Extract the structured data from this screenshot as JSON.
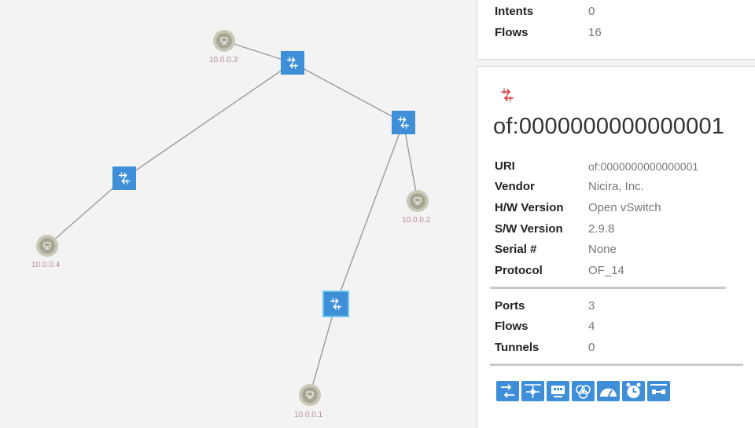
{
  "summary": {
    "rows": [
      {
        "label": "Intents",
        "value": "0"
      },
      {
        "label": "Flows",
        "value": "16"
      }
    ]
  },
  "device": {
    "icon": "switch-icon",
    "title": "of:0000000000000001",
    "props": [
      {
        "label": "URI",
        "value": "of:0000000000000001"
      },
      {
        "label": "Vendor",
        "value": "Nicira, Inc."
      },
      {
        "label": "H/W Version",
        "value": "Open vSwitch"
      },
      {
        "label": "S/W Version",
        "value": "2.9.8"
      },
      {
        "label": "Serial #",
        "value": "None"
      },
      {
        "label": "Protocol",
        "value": "OF_14"
      }
    ],
    "stats": [
      {
        "label": "Ports",
        "value": "3"
      },
      {
        "label": "Flows",
        "value": "4"
      },
      {
        "label": "Tunnels",
        "value": "0"
      }
    ],
    "actions": [
      "flow-view-icon",
      "port-table-icon",
      "group-table-icon",
      "meter-table-icon",
      "pipeconf-icon",
      "timeline-icon",
      "link-icon"
    ]
  },
  "topology": {
    "hosts": [
      {
        "label": "10.0.0.3"
      },
      {
        "label": "10.0.0.2"
      },
      {
        "label": "10.0.0.4"
      },
      {
        "label": "10.0.0.1"
      }
    ]
  },
  "colors": {
    "switch": "#3f8fd8",
    "switch_selected_border": "#6cc7ee",
    "host": "#c9c7b7",
    "link": "#9b9b9b",
    "host_label": "#b98d9e",
    "device_icon": "#d9363e"
  }
}
